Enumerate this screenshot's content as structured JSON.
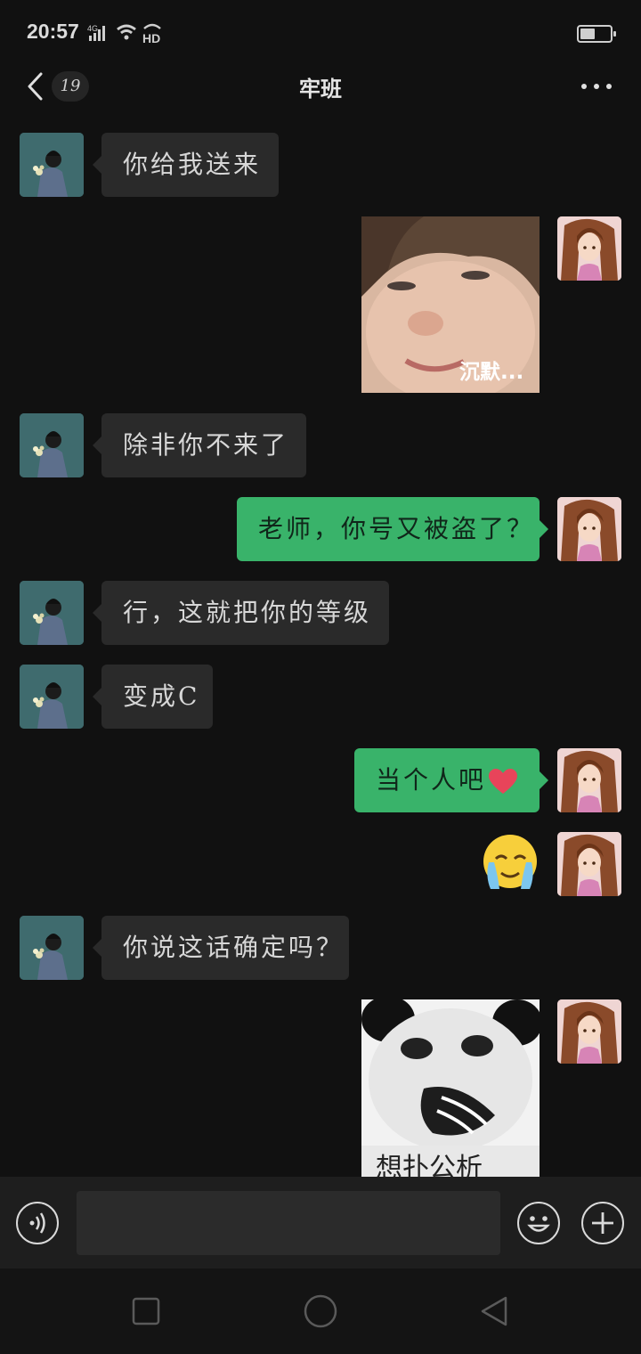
{
  "status_bar": {
    "time": "20:57",
    "network": "4G",
    "hd": "HD",
    "icons": [
      "signal-icon",
      "wifi-icon",
      "hd-call-icon",
      "battery-icon"
    ]
  },
  "nav": {
    "unread_count": "19",
    "title": "牢班",
    "icons": [
      "back-arrow-icon",
      "more-icon"
    ]
  },
  "messages": [
    {
      "side": "left",
      "type": "text",
      "text": "你给我送来"
    },
    {
      "side": "right",
      "type": "sticker",
      "caption": "沉默..."
    },
    {
      "side": "left",
      "type": "text",
      "text": "除非你不来了"
    },
    {
      "side": "right",
      "type": "text",
      "text": "老师，你号又被盗了？"
    },
    {
      "side": "left",
      "type": "text",
      "text": "行，这就把你的等级"
    },
    {
      "side": "left",
      "type": "text",
      "text": "变成C"
    },
    {
      "side": "right",
      "type": "text",
      "text": "当个人吧",
      "emoji": "heart-icon"
    },
    {
      "side": "right",
      "type": "sticker",
      "emoji": "crying-face"
    },
    {
      "side": "left",
      "type": "text",
      "text": "你说这话确定吗？"
    },
    {
      "side": "right",
      "type": "sticker",
      "caption": "想扑公析"
    }
  ],
  "input_bar": {
    "icons": [
      "voice-icon",
      "emoji-icon",
      "plus-icon"
    ]
  },
  "system_nav": {
    "icons": [
      "recents-icon",
      "home-icon",
      "back-triangle-icon"
    ]
  },
  "colors": {
    "background": "#111111",
    "incoming_bubble": "#2a2a2a",
    "outgoing_bubble": "#39b36a",
    "heart": "#e8445a"
  }
}
